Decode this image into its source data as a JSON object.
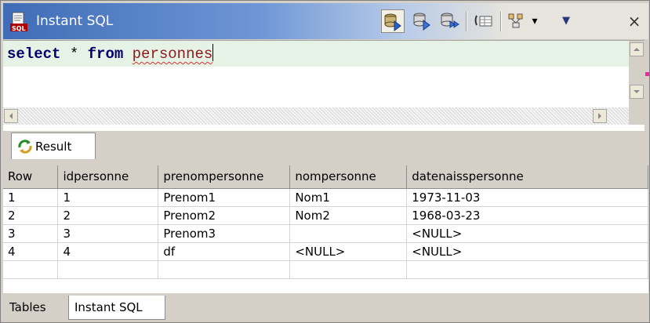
{
  "window": {
    "title": "Instant SQL",
    "close_glyph": "×"
  },
  "toolbar": {
    "buttons": [
      {
        "name": "execute-icon"
      },
      {
        "name": "execute-selection-icon"
      },
      {
        "name": "execute-script-icon"
      },
      {
        "name": "show-results-icon"
      },
      {
        "name": "commit-icon"
      }
    ],
    "dropdown_glyph": "▾",
    "view_menu_glyph": "▼"
  },
  "editor": {
    "sql_keyword_select": "select",
    "sql_star": "*",
    "sql_keyword_from": "from",
    "sql_table": "personnes"
  },
  "result_tab": {
    "label": "Result"
  },
  "table": {
    "columns": [
      "Row",
      "idpersonne",
      "prenompersonne",
      "nompersonne",
      "datenaisspersonne"
    ],
    "rows": [
      [
        "1",
        "1",
        "Prenom1",
        "Nom1",
        "1973-11-03"
      ],
      [
        "2",
        "2",
        "Prenom2",
        "Nom2",
        "1968-03-23"
      ],
      [
        "3",
        "3",
        "Prenom3",
        "",
        "<NULL>"
      ],
      [
        "4",
        "4",
        "df",
        "<NULL>",
        "<NULL>"
      ]
    ]
  },
  "bottom_tabs": [
    "Tables",
    "Instant SQL"
  ],
  "colors": {
    "title_gradient_start": "#3f6cb7",
    "keyword": "#00006b",
    "identifier": "#8b1a1a",
    "current_line": "#e6f2e6"
  }
}
